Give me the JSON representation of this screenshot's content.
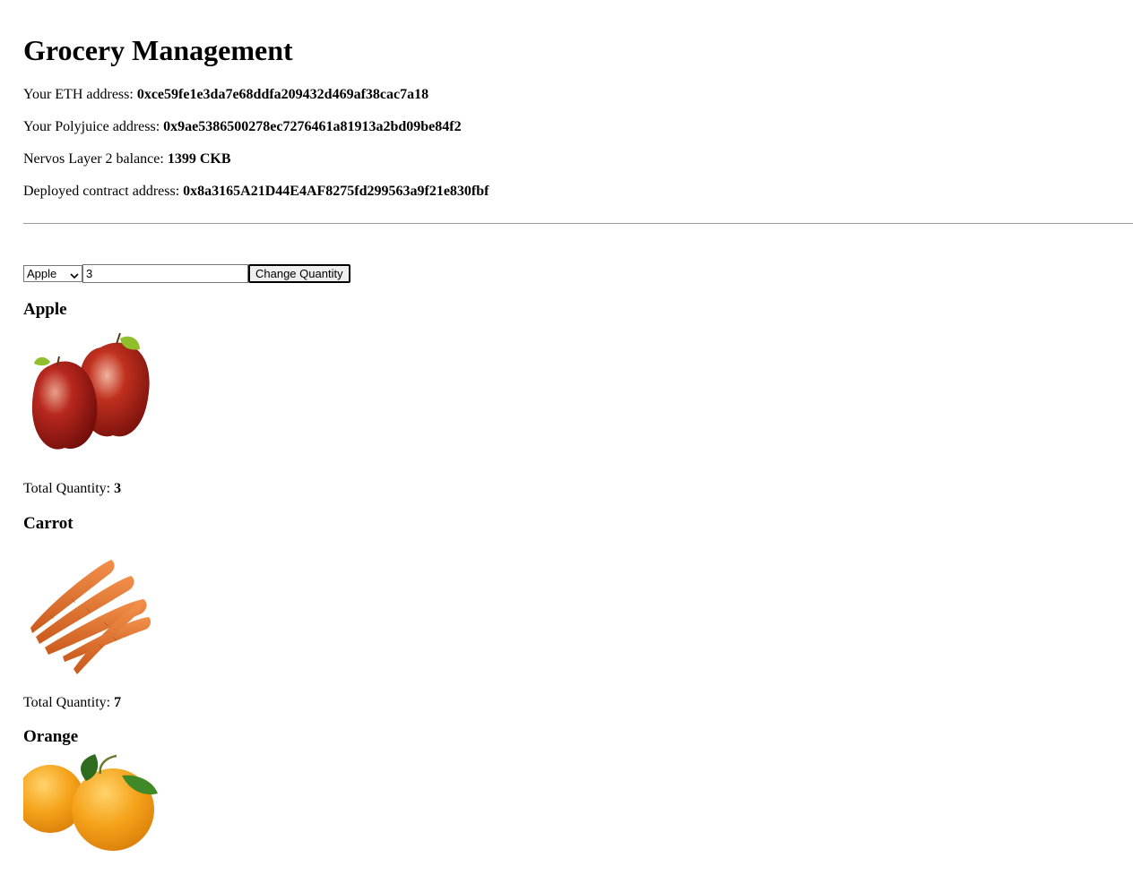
{
  "page": {
    "title": "Grocery Management"
  },
  "info": {
    "eth_label": "Your ETH address: ",
    "eth_value": "0xce59fe1e3da7e68ddfa209432d469af38cac7a18",
    "polyjuice_label": "Your Polyjuice address: ",
    "polyjuice_value": "0x9ae5386500278ec7276461a81913a2bd09be84f2",
    "balance_label": "Nervos Layer 2 balance: ",
    "balance_value": "1399 CKB",
    "contract_label": "Deployed contract address: ",
    "contract_value": "0x8a3165A21D44E4AF8275fd299563a9f21e830fbf"
  },
  "controls": {
    "selected_item": "Apple",
    "quantity_value": "3",
    "change_button_label": "Change Quantity"
  },
  "items": [
    {
      "name": "Apple",
      "image_icon": "apple-image",
      "total_label": "Total Quantity: ",
      "total_value": "3"
    },
    {
      "name": "Carrot",
      "image_icon": "carrot-image",
      "total_label": "Total Quantity: ",
      "total_value": "7"
    },
    {
      "name": "Orange",
      "image_icon": "orange-image"
    }
  ]
}
